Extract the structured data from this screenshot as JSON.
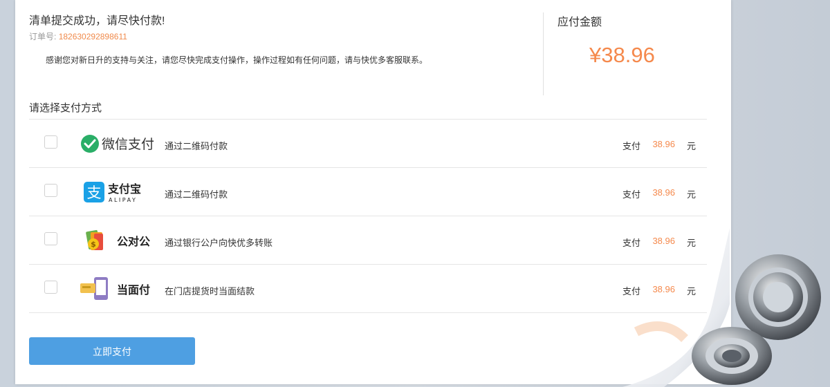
{
  "header": {
    "title": "清单提交成功，请尽快付款!",
    "order_label": "订单号:",
    "order_number": "182630292898611",
    "thanks": "感谢您对新日升的支持与关注，请您尽快完成支付操作，操作过程如有任何问题，请与快优多客服联系。"
  },
  "amount": {
    "label": "应付金额",
    "value": "¥38.96"
  },
  "payment": {
    "section_label": "请选择支付方式",
    "methods": [
      {
        "logo_text": "微信支付",
        "icon": "wechat-pay-icon",
        "desc": "通过二维码付款",
        "pay_label": "支付",
        "amount": "38.96",
        "unit": "元",
        "checked": false
      },
      {
        "logo_text": "支付宝",
        "logo_sub": "ALIPAY",
        "icon": "alipay-icon",
        "desc": "通过二维码付款",
        "pay_label": "支付",
        "amount": "38.96",
        "unit": "元",
        "checked": false
      },
      {
        "logo_text": "公对公",
        "icon": "bank-transfer-icon",
        "desc": "通过银行公户向快优多转账",
        "pay_label": "支付",
        "amount": "38.96",
        "unit": "元",
        "checked": false
      },
      {
        "logo_text": "当面付",
        "icon": "face-to-face-pay-icon",
        "desc": "在门店提货时当面结款",
        "pay_label": "支付",
        "amount": "38.96",
        "unit": "元",
        "checked": false
      }
    ]
  },
  "button": {
    "label": "立即支付"
  },
  "colors": {
    "accent": "#f5894c",
    "button": "#4e9fe2",
    "wechat": "#2aae67",
    "alipay": "#1aa1e6"
  }
}
